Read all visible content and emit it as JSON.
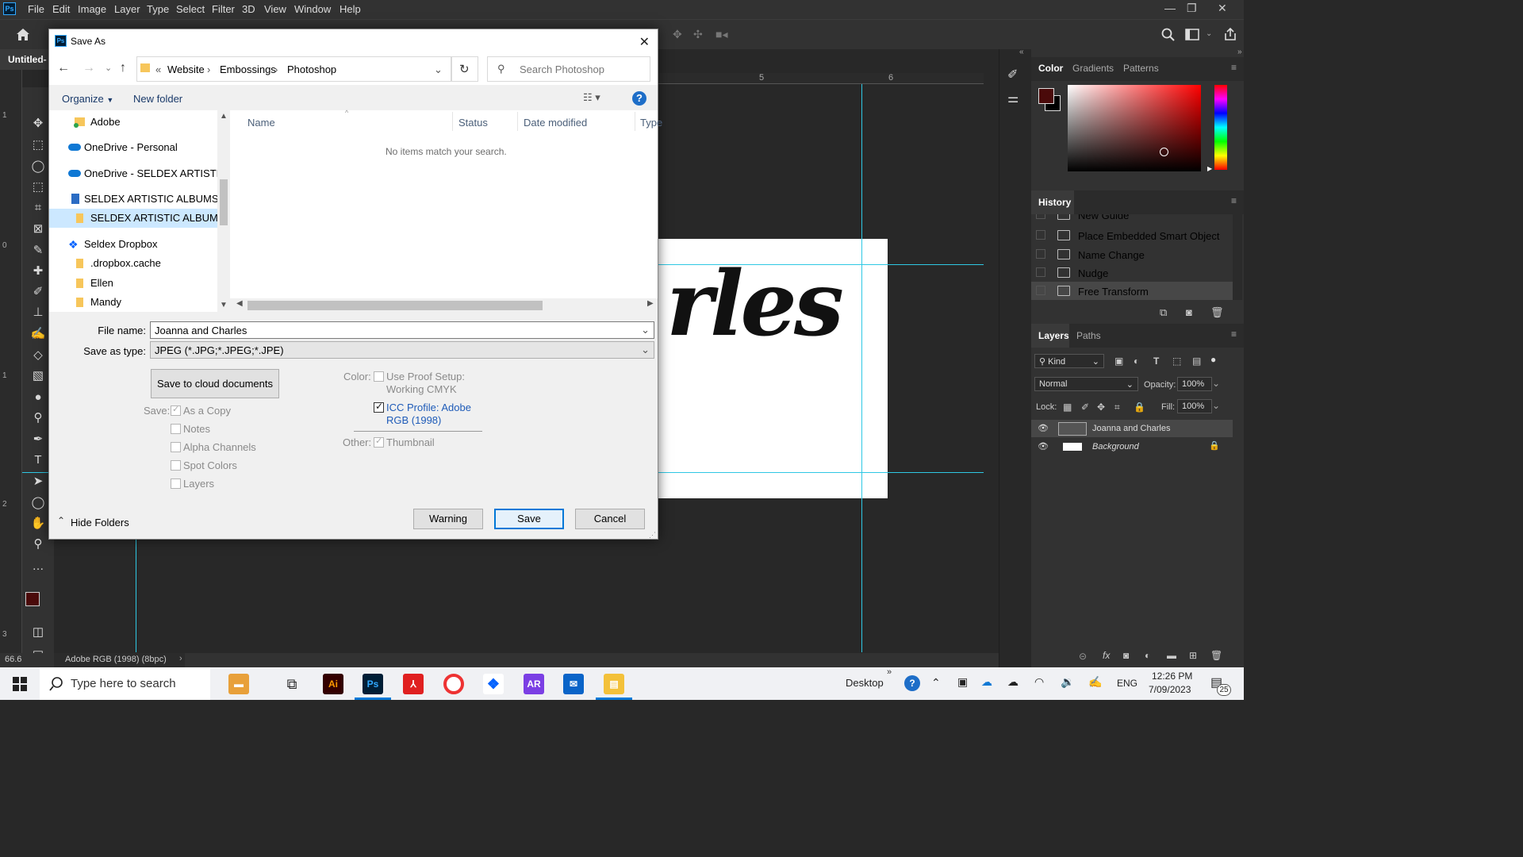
{
  "menubar": {
    "items": [
      "File",
      "Edit",
      "Image",
      "Layer",
      "Type",
      "Select",
      "Filter",
      "3D",
      "View",
      "Window",
      "Help"
    ],
    "logo": "Ps"
  },
  "document": {
    "tab_title": "Untitled-",
    "zoom": "66.6",
    "color_profile": "Adobe RGB (1998) (8bpc)",
    "canvas_text": "rles",
    "ruler_top": [
      "5",
      "6"
    ],
    "ruler_left": [
      "1",
      "0",
      "1",
      "2",
      "3"
    ]
  },
  "dialog": {
    "title": "Save As",
    "logo": "Ps",
    "breadcrumb": [
      "Website",
      "Embossings",
      "Photoshop"
    ],
    "breadcrumb_prefix": "«",
    "search_placeholder": "Search Photoshop",
    "organize": "Organize",
    "new_folder": "New folder",
    "tree": [
      {
        "label": "Adobe",
        "icon": "folder-sync-icon"
      },
      {
        "label": "OneDrive - Personal",
        "icon": "onedrive-icon"
      },
      {
        "label": "OneDrive - SELDEX ARTISTIC A",
        "icon": "onedrive-icon"
      },
      {
        "label": "SELDEX ARTISTIC ALBUMS",
        "icon": "building-icon"
      },
      {
        "label": "SELDEX ARTISTIC ALBUMS - C",
        "icon": "folder-icon"
      },
      {
        "label": "Seldex Dropbox",
        "icon": "dropbox-icon"
      },
      {
        "label": ".dropbox.cache",
        "icon": "folder-icon"
      },
      {
        "label": "Ellen",
        "icon": "folder-icon"
      },
      {
        "label": "Mandy",
        "icon": "folder-icon"
      }
    ],
    "columns": [
      "Name",
      "Status",
      "Date modified",
      "Type"
    ],
    "empty_message": "No items match your search.",
    "file_name_label": "File name:",
    "file_name": "Joanna and Charles",
    "save_type_label": "Save as type:",
    "save_type": "JPEG (*.JPG;*.JPEG;*.JPE)",
    "cloud_button": "Save to cloud documents",
    "save_label": "Save:",
    "save_options": [
      {
        "label": "As a Copy",
        "checked": true,
        "disabled": true
      },
      {
        "label": "Notes",
        "checked": false,
        "disabled": true
      },
      {
        "label": "Alpha Channels",
        "checked": false,
        "disabled": true
      },
      {
        "label": "Spot Colors",
        "checked": false,
        "disabled": true
      },
      {
        "label": "Layers",
        "checked": false,
        "disabled": true
      }
    ],
    "color_label": "Color:",
    "use_proof": "Use Proof Setup:",
    "working_cmyk": "Working CMYK",
    "icc_line1": "ICC Profile:  Adobe",
    "icc_line2": "RGB (1998)",
    "other_label": "Other:",
    "thumbnail": "Thumbnail",
    "hide_folders": "Hide Folders",
    "warning": "Warning",
    "save": "Save",
    "cancel": "Cancel"
  },
  "color_panel": {
    "tabs": [
      "Color",
      "Gradients",
      "Patterns"
    ],
    "foreground": "#4a0a0a"
  },
  "history": {
    "title": "History",
    "items": [
      "New Guide",
      "Place Embedded Smart Object",
      "Name Change",
      "Nudge",
      "Free Transform"
    ]
  },
  "layers": {
    "tabs": [
      "Layers",
      "Paths"
    ],
    "filter": "Kind",
    "blend": "Normal",
    "opacity_label": "Opacity:",
    "opacity": "100%",
    "lock_label": "Lock:",
    "fill_label": "Fill:",
    "fill": "100%",
    "items": [
      "Joanna and Charles",
      "Background"
    ]
  },
  "taskbar": {
    "search_placeholder": "Type here to search",
    "desktop": "Desktop",
    "language": "ENG",
    "time": "12:26 PM",
    "date": "7/09/2023",
    "notifications": "25",
    "apps": [
      "Ai",
      "Ps",
      "AR"
    ]
  }
}
